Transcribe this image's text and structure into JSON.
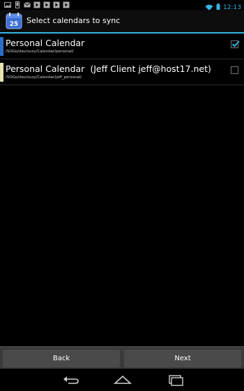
{
  "status_bar": {
    "time": "12:13",
    "left_icons": [
      "image-icon",
      "phone-icon",
      "mail-icon",
      "media-icon",
      "media-icon",
      "media-icon",
      "media-icon"
    ],
    "right_icons": [
      "wifi-icon",
      "battery-icon"
    ]
  },
  "action_bar": {
    "title": "Select calendars to sync",
    "icon_text": "25"
  },
  "calendars": [
    {
      "name": "Personal Calendar",
      "owner": "",
      "path": "/SOGo/dav/suzy/Calendar/personal/",
      "color": "#2b6fc4",
      "checked": true
    },
    {
      "name": "Personal Calendar",
      "owner": "(Jeff Client jeff@host17.net)",
      "path": "/SOGo/dav/suzy/Calendar/jeff_personal/",
      "color": "#e8e3b0",
      "checked": false
    }
  ],
  "buttons": {
    "back_label": "Back",
    "next_label": "Next"
  },
  "colors": {
    "accent": "#33b5e5"
  }
}
